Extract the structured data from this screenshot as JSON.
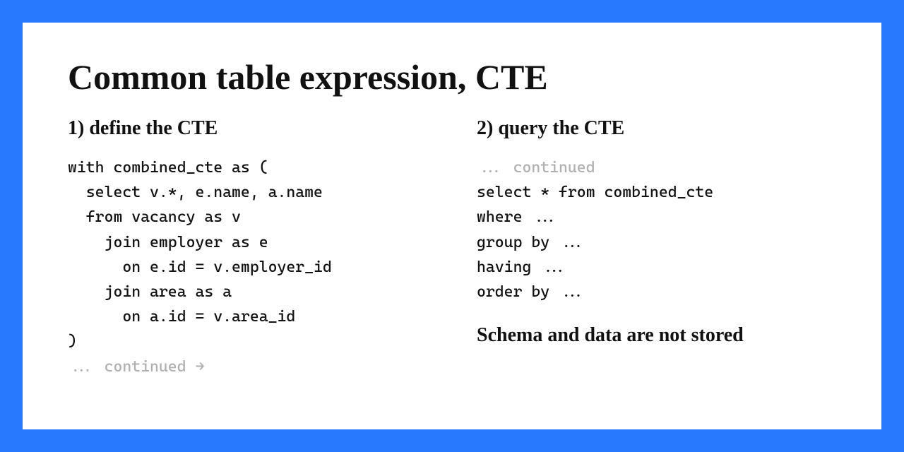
{
  "title": "Common table expression, CTE",
  "left": {
    "heading": "1) define the CTE",
    "code_lines": [
      "with combined_cte as (",
      "  select v.*, e.name, a.name",
      "  from vacancy as v",
      "    join employer as e",
      "      on e.id = v.employer_id",
      "    join area as a",
      "      on a.id = v.area_id",
      ")"
    ],
    "continued_prefix": "...",
    "continued_text": " continued →"
  },
  "right": {
    "heading": "2) query the CTE",
    "continued_prefix": "...",
    "continued_text": " continued",
    "code_lines": [
      "select * from combined_cte",
      "where ...",
      "group by ...",
      "having ...",
      "order by ..."
    ],
    "note": "Schema and data are not stored"
  }
}
